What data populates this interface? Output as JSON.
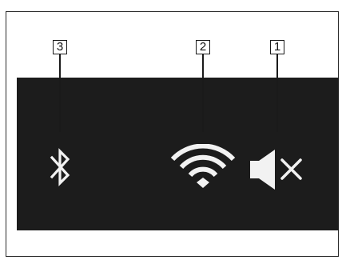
{
  "callouts": [
    {
      "number": "3",
      "target": "bluetooth"
    },
    {
      "number": "2",
      "target": "wifi"
    },
    {
      "number": "1",
      "target": "mute"
    }
  ],
  "icons": {
    "bluetooth": "bluetooth-icon",
    "wifi": "wifi-icon",
    "mute": "speaker-muted-icon"
  },
  "colors": {
    "panel": "#1c1c1c",
    "icon": "#f2f2f2",
    "callout": "#1a1a1a"
  }
}
